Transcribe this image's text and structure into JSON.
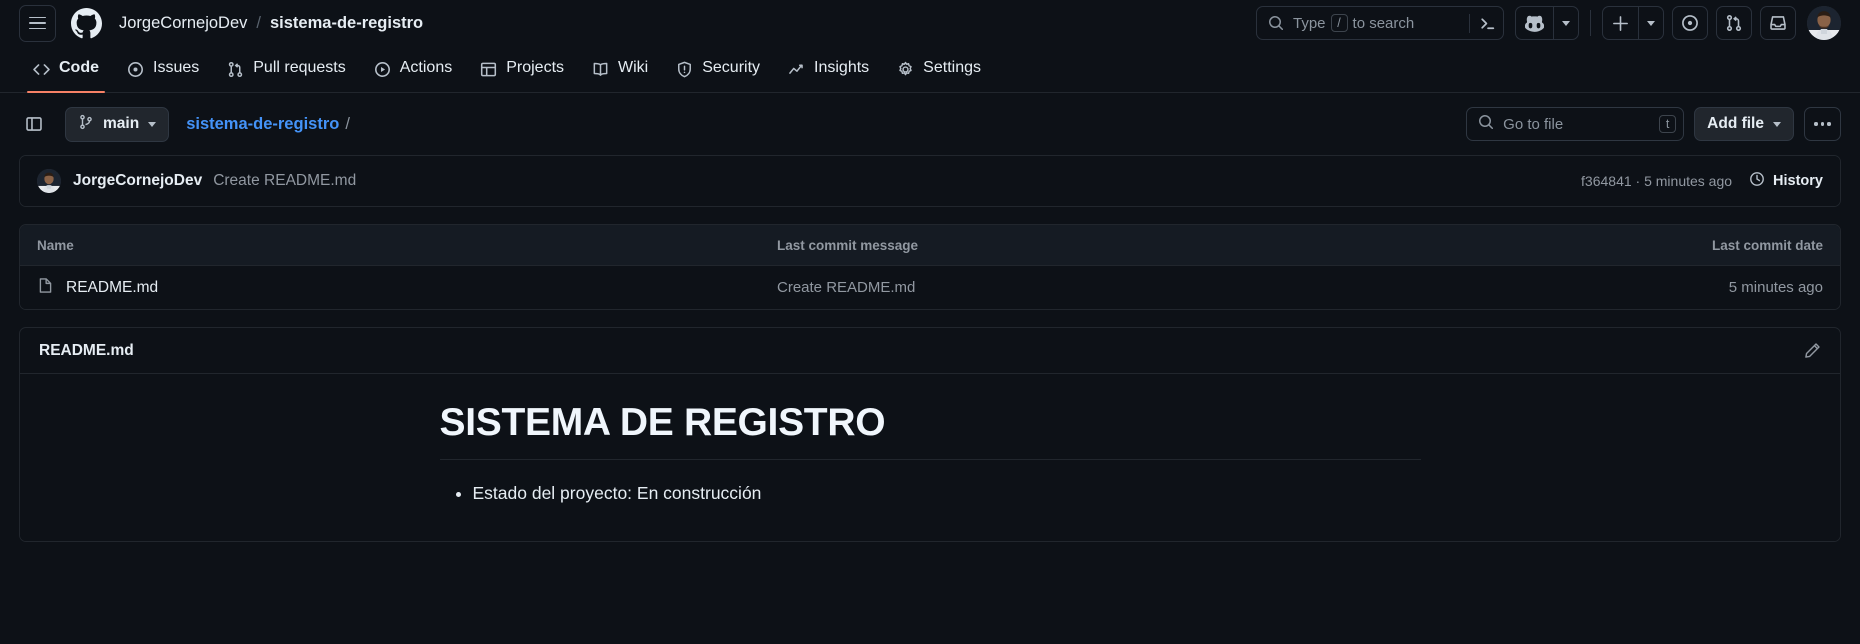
{
  "header": {
    "menu_icon": "hamburger-icon",
    "logo_icon": "github-logo-icon",
    "owner": "JorgeCornejoDev",
    "separator": "/",
    "repo": "sistema-de-registro",
    "search": {
      "icon": "search-icon",
      "prefix": "Type",
      "kbd": "/",
      "suffix": "to search",
      "terminal_icon": "terminal-icon"
    },
    "copilot_icon": "copilot-icon",
    "copilot_caret_icon": "chevron-down-icon",
    "create_new_icon": "plus-icon",
    "create_new_caret_icon": "chevron-down-icon",
    "issues_icon": "issue-opened-icon",
    "pull_requests_icon": "git-pull-request-icon",
    "notifications_icon": "inbox-icon",
    "avatar": "user-avatar"
  },
  "repo_nav": {
    "tabs": [
      {
        "label": "Code",
        "icon": "code-icon",
        "active": true
      },
      {
        "label": "Issues",
        "icon": "issue-opened-icon",
        "active": false
      },
      {
        "label": "Pull requests",
        "icon": "git-pull-request-icon",
        "active": false
      },
      {
        "label": "Actions",
        "icon": "play-icon",
        "active": false
      },
      {
        "label": "Projects",
        "icon": "table-icon",
        "active": false
      },
      {
        "label": "Wiki",
        "icon": "book-icon",
        "active": false
      },
      {
        "label": "Security",
        "icon": "shield-icon",
        "active": false
      },
      {
        "label": "Insights",
        "icon": "graph-icon",
        "active": false
      },
      {
        "label": "Settings",
        "icon": "gear-icon",
        "active": false
      }
    ]
  },
  "toolbar": {
    "sidebar_toggle_icon": "sidebar-expand-icon",
    "branch_icon": "git-branch-icon",
    "branch_name": "main",
    "branch_caret_icon": "chevron-down-icon",
    "breadcrumb_repo": "sistema-de-registro",
    "breadcrumb_sep": "/",
    "go_to_file": {
      "icon": "search-icon",
      "placeholder": "Go to file",
      "kbd": "t"
    },
    "add_file_label": "Add file",
    "add_file_caret_icon": "chevron-down-icon",
    "kebab_icon": "kebab-horizontal-icon"
  },
  "latest_commit": {
    "avatar": "commit-author-avatar",
    "author": "JorgeCornejoDev",
    "message": "Create README.md",
    "sha": "f364841",
    "meta_separator": "·",
    "relative_time": "5 minutes ago",
    "meta": "f364841 · 5 minutes ago",
    "history_icon": "history-icon",
    "history_label": "History"
  },
  "file_table": {
    "columns": {
      "name": "Name",
      "message": "Last commit message",
      "date": "Last commit date"
    },
    "rows": [
      {
        "icon": "file-icon",
        "name": "README.md",
        "message": "Create README.md",
        "date": "5 minutes ago"
      }
    ]
  },
  "readme": {
    "title": "README.md",
    "edit_icon": "pencil-icon",
    "heading": "SISTEMA DE REGISTRO",
    "bullets": [
      "Estado del proyecto: En construcción"
    ]
  },
  "colors": {
    "page_bg": "#0d1117",
    "border": "#21262d",
    "accent_tab": "#f78166",
    "link": "#4493f8",
    "muted_text": "#9198a1",
    "text": "#e6edf3",
    "button_bg": "#21262d",
    "table_head_bg": "#151b23"
  }
}
